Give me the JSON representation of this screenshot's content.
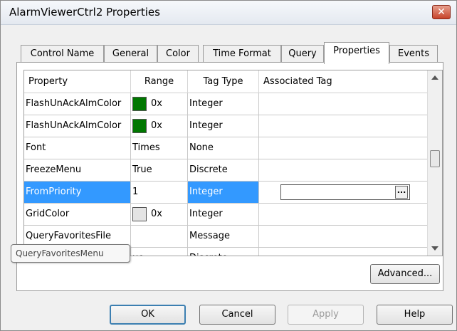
{
  "window": {
    "title": "AlarmViewerCtrl2 Properties",
    "close_glyph": "✕"
  },
  "tabs": [
    {
      "label": "Control Name"
    },
    {
      "label": "General"
    },
    {
      "label": "Color"
    },
    {
      "label": "Time Format"
    },
    {
      "label": "Query"
    },
    {
      "label": "Properties",
      "active": true
    },
    {
      "label": "Events"
    }
  ],
  "grid": {
    "headers": [
      "Property",
      "Range",
      "Tag Type",
      "Associated Tag"
    ],
    "rows": [
      {
        "property": "FlashUnAckAlmColor",
        "range": "0x",
        "swatch": "#007700",
        "tag_type": "Integer",
        "associated": ""
      },
      {
        "property": "FlashUnAckAlmColor",
        "range": "0x",
        "swatch": "#007700",
        "tag_type": "Integer",
        "associated": ""
      },
      {
        "property": "Font",
        "range": "Times",
        "tag_type": "None",
        "associated": ""
      },
      {
        "property": "FreezeMenu",
        "range": "True",
        "tag_type": "Discrete",
        "associated": ""
      },
      {
        "property": "FromPriority",
        "range": "1",
        "tag_type": "Integer",
        "associated": "",
        "selected": true,
        "browse_glyph": "..."
      },
      {
        "property": "GridColor",
        "range": "0x",
        "swatch": "#e4e4e4",
        "tag_type": "Integer",
        "associated": ""
      },
      {
        "property": "QueryFavoritesFile",
        "range": "",
        "tag_type": "Message",
        "associated": ""
      },
      {
        "property": "",
        "range": "ue",
        "tag_type": "Discrete",
        "associated": ""
      }
    ]
  },
  "tooltip": {
    "text": "QueryFavoritesMenu"
  },
  "buttons": {
    "advanced": "Advanced...",
    "ok": "OK",
    "cancel": "Cancel",
    "apply": "Apply",
    "help": "Help"
  },
  "colors": {
    "selection": "#3399ff",
    "green_swatch": "#007700",
    "gray_swatch": "#e4e4e4"
  }
}
